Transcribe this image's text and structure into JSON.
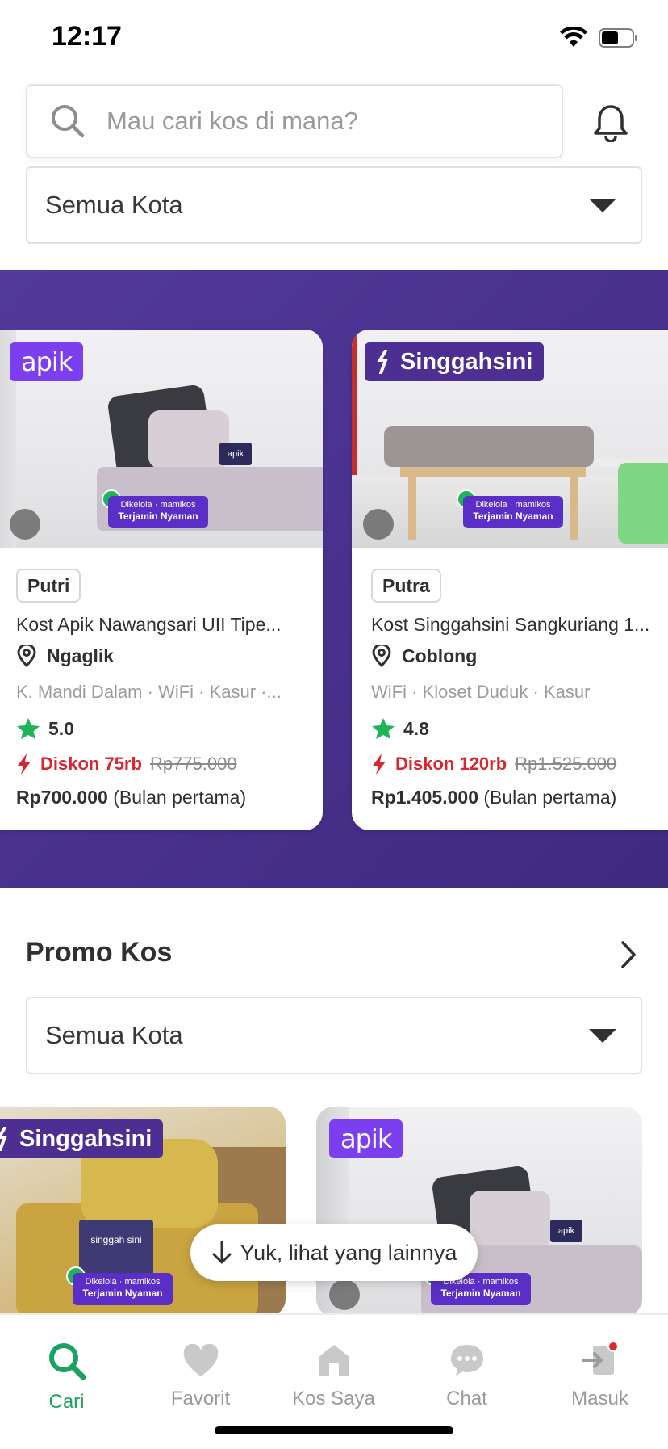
{
  "status_bar": {
    "time": "12:17"
  },
  "search": {
    "placeholder": "Mau cari kos di mana?"
  },
  "city_filter_top": {
    "label": "Semua Kota"
  },
  "featured_cards": [
    {
      "brand": "apik",
      "gender": "Putri",
      "title": "Kost Apik Nawangsari UII Tipe...",
      "area": "Ngaglik",
      "facilities": "K. Mandi Dalam · WiFi · Kasur ·...",
      "rating": "5.0",
      "discount": "Diskon 75rb",
      "old_price": "Rp775.000",
      "price": "Rp700.000",
      "price_note": "(Bulan pertama)",
      "managed_line1": "Dikelola",
      "managed_brand": "mamikos",
      "managed_line2": "Terjamin Nyaman",
      "pillow_label": "apik"
    },
    {
      "brand": "Singgahsini",
      "gender": "Putra",
      "title": "Kost Singgahsini Sangkuriang 1...",
      "area": "Coblong",
      "facilities": "WiFi · Kloset Duduk · Kasur",
      "rating": "4.8",
      "discount": "Diskon 120rb",
      "old_price": "Rp1.525.000",
      "price": "Rp1.405.000",
      "price_note": "(Bulan pertama)",
      "managed_line1": "Dikelola",
      "managed_brand": "mamikos",
      "managed_line2": "Terjamin Nyaman"
    }
  ],
  "promo": {
    "title": "Promo Kos",
    "city_filter": "Semua Kota",
    "cards": [
      {
        "brand": "Singgahsini",
        "managed_line1": "Dikelola",
        "managed_brand": "mamikos",
        "managed_line2": "Terjamin Nyaman",
        "pillow_label": "singgah sini"
      },
      {
        "brand": "apik",
        "managed_line1": "Dikelola",
        "managed_brand": "mamikos",
        "managed_line2": "Terjamin Nyaman",
        "pillow_label": "apik"
      }
    ]
  },
  "toast": {
    "label": "Yuk, lihat yang lainnya"
  },
  "bottom_nav": [
    {
      "label": "Cari",
      "icon": "search-icon",
      "active": true
    },
    {
      "label": "Favorit",
      "icon": "heart-icon",
      "active": false
    },
    {
      "label": "Kos Saya",
      "icon": "home-icon",
      "active": false
    },
    {
      "label": "Chat",
      "icon": "chat-bubble-icon",
      "active": false
    },
    {
      "label": "Masuk",
      "icon": "login-icon",
      "active": false
    }
  ],
  "colors": {
    "accent_green": "#1aa260",
    "banner_purple": "#48308c",
    "discount_red": "#d8262f",
    "apik_purple": "#7b3ff0"
  }
}
